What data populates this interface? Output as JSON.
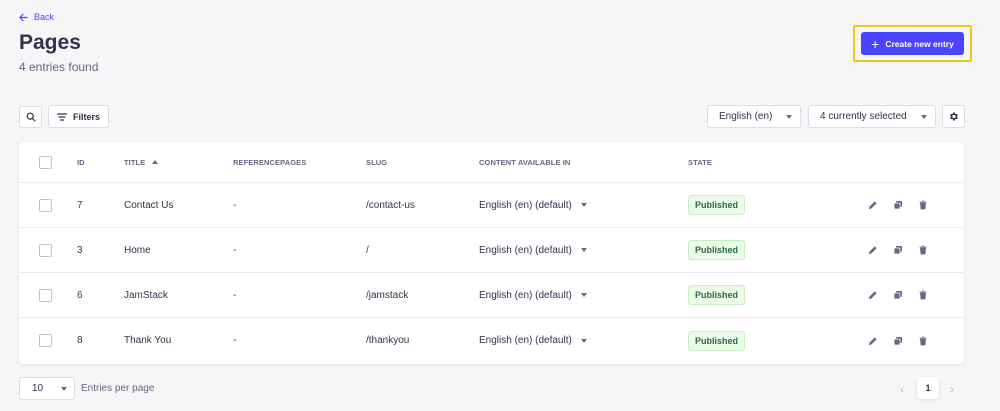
{
  "header": {
    "back_label": "Back",
    "title": "Pages",
    "subtitle": "4 entries found",
    "create_label": "Create new entry"
  },
  "toolbar": {
    "filters_label": "Filters",
    "locale_value": "English (en)",
    "columns_value": "4 currently selected"
  },
  "table": {
    "columns": [
      "ID",
      "TITLE",
      "REFERENCEPAGES",
      "SLUG",
      "CONTENT AVAILABLE IN",
      "STATE"
    ],
    "rows": [
      {
        "id": "7",
        "title": "Contact Us",
        "referencepages": "-",
        "slug": "/contact-us",
        "content": "English (en) (default)",
        "state": "Published"
      },
      {
        "id": "3",
        "title": "Home",
        "referencepages": "-",
        "slug": "/",
        "content": "English (en) (default)",
        "state": "Published"
      },
      {
        "id": "6",
        "title": "JamStack",
        "referencepages": "-",
        "slug": "/jamstack",
        "content": "English (en) (default)",
        "state": "Published"
      },
      {
        "id": "8",
        "title": "Thank You",
        "referencepages": "-",
        "slug": "/thankyou",
        "content": "English (en) (default)",
        "state": "Published"
      }
    ]
  },
  "footer": {
    "per_page_value": "10",
    "per_page_label": "Entries per page",
    "current_page": "1",
    "prev_icon": "‹",
    "next_icon": "›"
  },
  "colors": {
    "primary": "#4945ff",
    "published_bg": "#eafbe7",
    "published_text": "#2f6846",
    "highlight": "#f5c518"
  }
}
